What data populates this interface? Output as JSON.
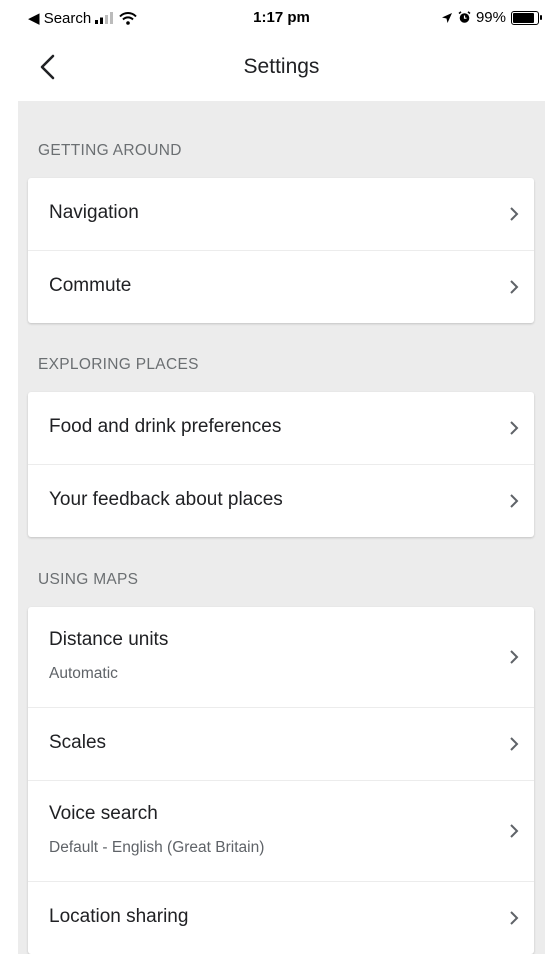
{
  "status_bar": {
    "back_app": "◀ Search",
    "time": "1:17 pm",
    "battery": "99%"
  },
  "header": {
    "title": "Settings"
  },
  "sections": [
    {
      "title": "GETTING AROUND",
      "items": [
        {
          "label": "Navigation"
        },
        {
          "label": "Commute"
        }
      ]
    },
    {
      "title": "EXPLORING PLACES",
      "items": [
        {
          "label": "Food and drink preferences"
        },
        {
          "label": "Your feedback about places"
        }
      ]
    },
    {
      "title": "USING MAPS",
      "items": [
        {
          "label": "Distance units",
          "sublabel": "Automatic"
        },
        {
          "label": "Scales"
        },
        {
          "label": "Voice search",
          "sublabel": "Default - English (Great Britain)"
        },
        {
          "label": "Location sharing"
        }
      ]
    }
  ]
}
